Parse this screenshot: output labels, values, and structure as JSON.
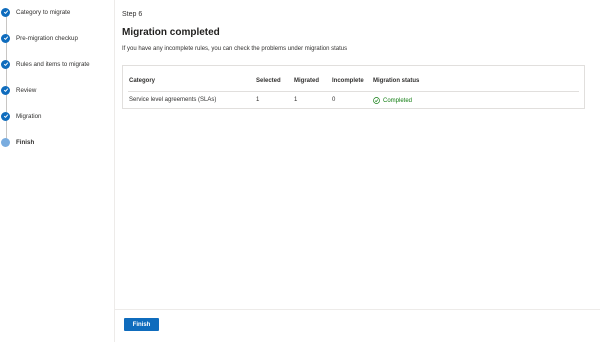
{
  "sidebar": {
    "steps": [
      {
        "label": "Category to migrate",
        "status": "completed"
      },
      {
        "label": "Pre-migration checkup",
        "status": "completed"
      },
      {
        "label": "Rules and items to migrate",
        "status": "completed"
      },
      {
        "label": "Review",
        "status": "completed"
      },
      {
        "label": "Migration",
        "status": "completed"
      },
      {
        "label": "Finish",
        "status": "current"
      }
    ]
  },
  "main": {
    "step_title": "Step 6",
    "title": "Migration completed",
    "subtitle": "If you have any incomplete rules, you can check the problems under migration status",
    "table": {
      "headers": [
        "Category",
        "Selected",
        "Migrated",
        "Incomplete",
        "Migration status"
      ],
      "rows": [
        {
          "category": "Service level agreements (SLAs)",
          "selected": "1",
          "migrated": "1",
          "incomplete": "0",
          "status": "Completed",
          "status_icon": "check-circle-icon"
        }
      ]
    }
  },
  "footer": {
    "finish_label": "Finish"
  },
  "colors": {
    "accent": "#0f6cbd",
    "current_step": "#79acdf",
    "success": "#107c10"
  }
}
